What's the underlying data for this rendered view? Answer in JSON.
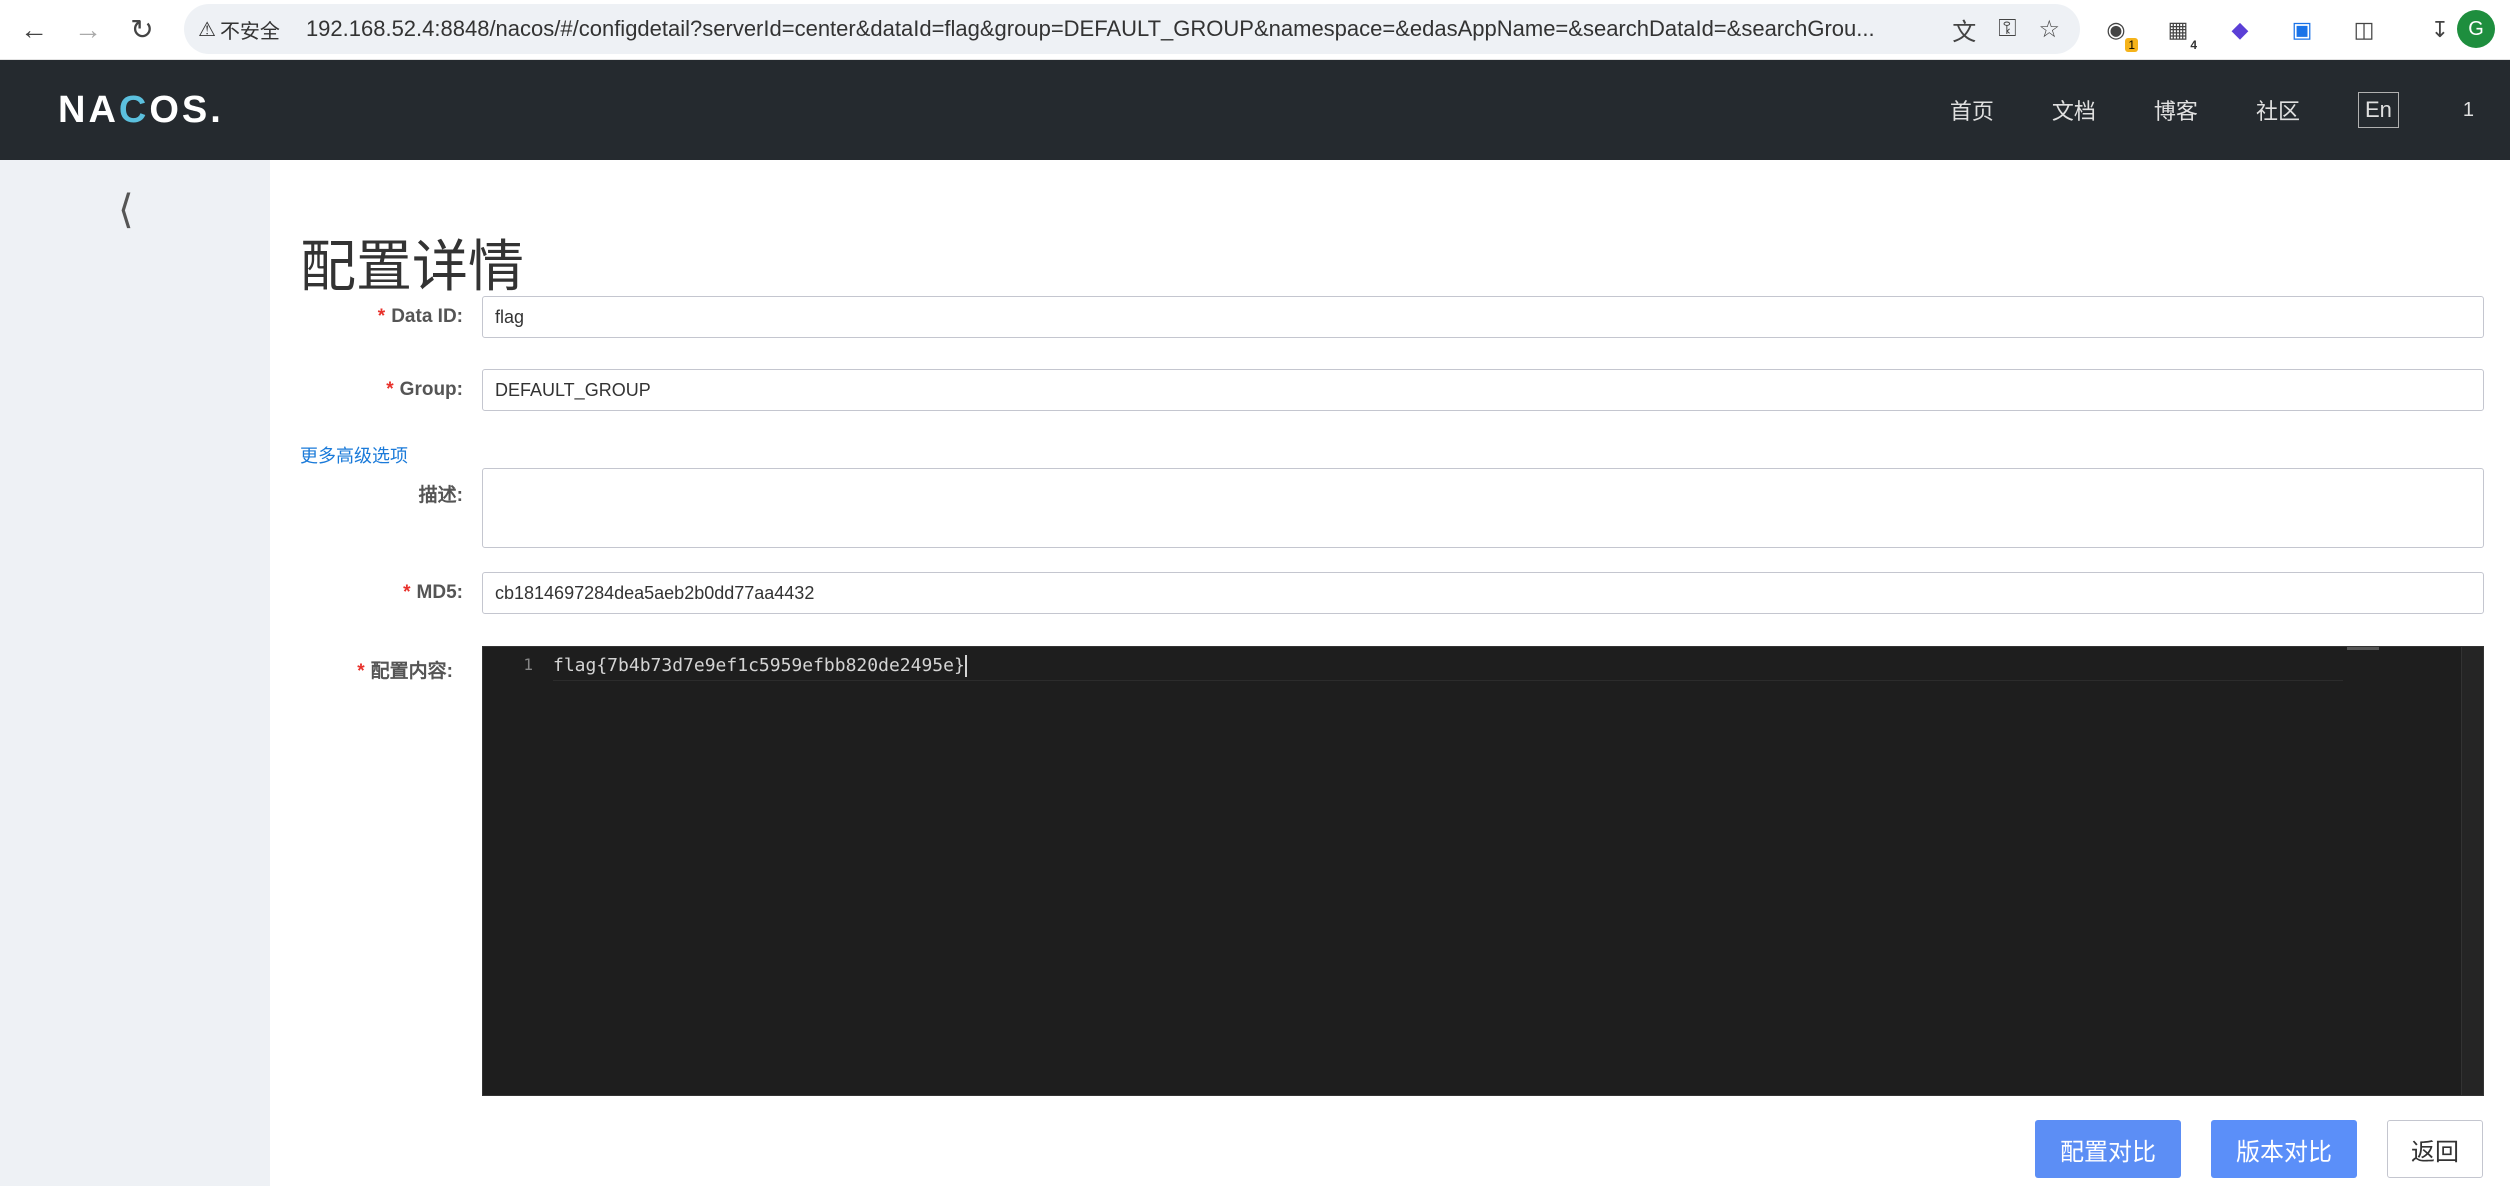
{
  "browser": {
    "security_label": "不安全",
    "url": "192.168.52.4:8848/nacos/#/configdetail?serverId=center&dataId=flag&group=DEFAULT_GROUP&namespace=&edasAppName=&searchDataId=&searchGrou...",
    "ext_badge_1": "1",
    "ext_badge_2": "4",
    "profile_initial": "G"
  },
  "header": {
    "logo": "NACOS.",
    "menu": [
      "首页",
      "文档",
      "博客",
      "社区"
    ],
    "language": "En",
    "user": "1"
  },
  "page": {
    "title": "配置详情",
    "more_options": "更多高级选项"
  },
  "form": {
    "data_id": {
      "label": "Data ID:",
      "value": "flag"
    },
    "group": {
      "label": "Group:",
      "value": "DEFAULT_GROUP"
    },
    "description": {
      "label": "描述:",
      "value": ""
    },
    "md5": {
      "label": "MD5:",
      "value": "cb1814697284dea5aeb2b0dd77aa4432"
    },
    "content": {
      "label": "配置内容:",
      "line_number": "1",
      "line_text": "flag{7b4b73d7e9ef1c5959efbb820de2495e}"
    }
  },
  "buttons": {
    "config_compare": "配置对比",
    "version_compare": "版本对比",
    "back": "返回"
  }
}
